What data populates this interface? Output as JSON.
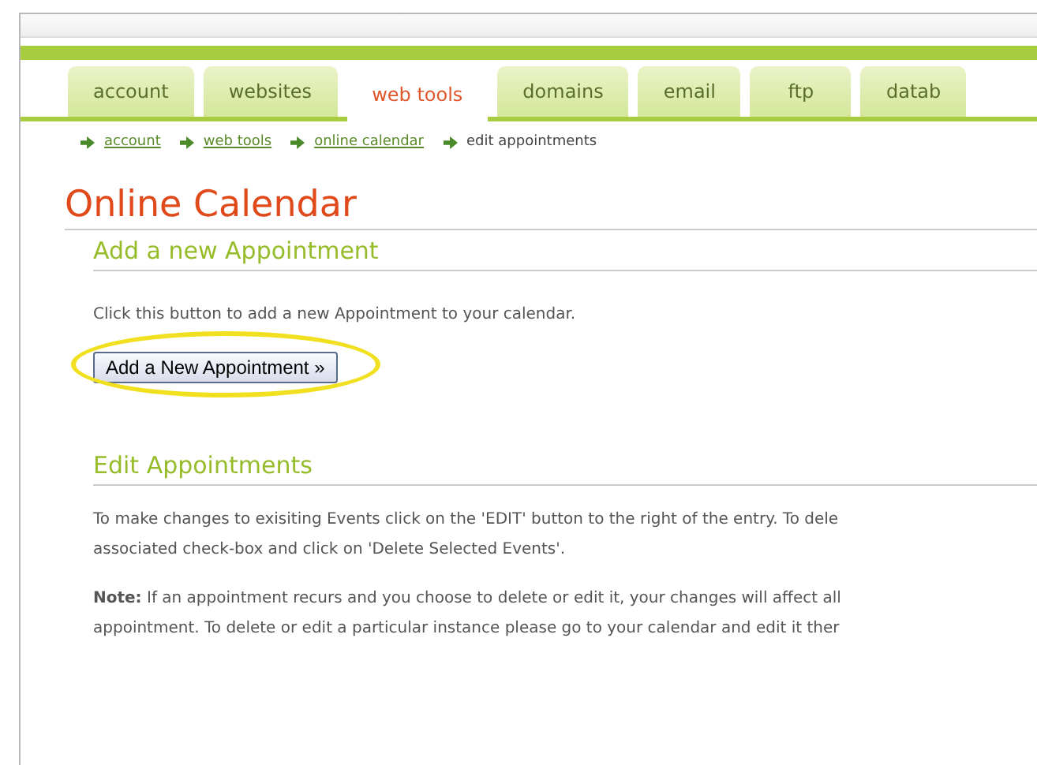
{
  "tabs": [
    {
      "label": "account",
      "selected": false
    },
    {
      "label": "websites",
      "selected": false
    },
    {
      "label": "web tools",
      "selected": true
    },
    {
      "label": "domains",
      "selected": false
    },
    {
      "label": "email",
      "selected": false
    },
    {
      "label": "ftp",
      "selected": false
    },
    {
      "label": "datab",
      "selected": false
    }
  ],
  "breadcrumb": [
    {
      "label": "account",
      "link": true
    },
    {
      "label": "web tools",
      "link": true
    },
    {
      "label": "online calendar",
      "link": true
    },
    {
      "label": "edit appointments",
      "link": false
    }
  ],
  "page_title": "Online Calendar",
  "add_section": {
    "heading": "Add a new Appointment",
    "text": "Click this button to add a new Appointment to your calendar.",
    "button": "Add a New Appointment »",
    "highlighted": true
  },
  "edit_section": {
    "heading": "Edit Appointments",
    "paragraphs": [
      [
        "To make changes to exisiting Events click on the 'EDIT' button to the right of the entry. To dele",
        "associated check-box and click on 'Delete Selected Events'."
      ],
      [
        "**Note:** If an appointment recurs and you choose to delete or edit it, your changes will affect all",
        "appointment. To delete or edit a particular instance please go to your calendar and edit it ther"
      ]
    ]
  }
}
